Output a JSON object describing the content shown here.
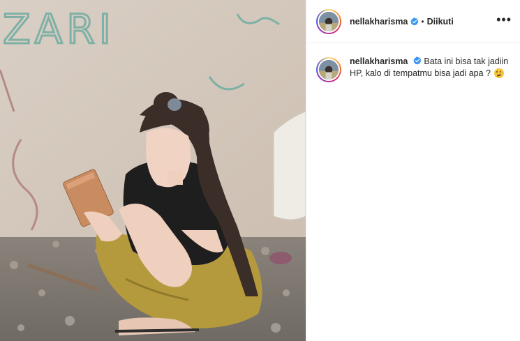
{
  "post": {
    "username": "nellakharisma",
    "follow_separator": "•",
    "follow_status": "Diikuti",
    "more_label": "•••",
    "caption_username": "nellakharisma",
    "caption_text": "Bata ini bisa tak jadiin HP, kalo di tempatmu bisa jadi apa ?",
    "caption_emoji": "thinking-face-emoji",
    "verified_icon": "verified-badge-icon",
    "verified_color": "#3897f0",
    "story_ring_colors": [
      "#feda75",
      "#fa7e1e",
      "#d62976",
      "#962fbf",
      "#4f5bd5"
    ],
    "photo_graffiti": "ZARI"
  }
}
